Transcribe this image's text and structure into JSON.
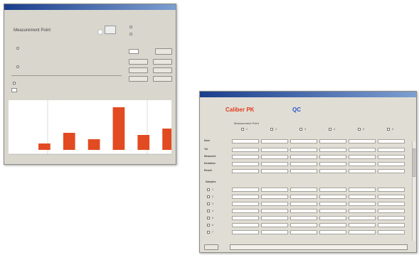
{
  "measure_window": {
    "title": "",
    "menu_label": "",
    "heading": "Measurement Point",
    "option_labels": [
      "",
      "",
      ""
    ],
    "checkbox_label": "",
    "right_group_title": "",
    "right_radio_labels": [
      "",
      ""
    ],
    "spin_value": "",
    "button_labels": [
      "",
      "",
      "",
      "",
      "",
      ""
    ],
    "chart_caption": "",
    "chart_data": {
      "type": "bar",
      "categories": [
        "",
        "",
        "",
        "",
        "",
        ""
      ],
      "values": [
        3,
        8,
        5,
        20,
        7,
        10
      ],
      "ylim": [
        0,
        22
      ],
      "bar_color": "#e24a21",
      "grid": true
    }
  },
  "spc_window": {
    "title": "",
    "menu_items": [
      "",
      "",
      "",
      "",
      "",
      ""
    ],
    "brand": "Caliber PK",
    "qc_label": "QC",
    "right_info": [
      "",
      ""
    ],
    "section_title": "Measurement Point",
    "column_numbers": [
      "1",
      "2",
      "3",
      "4",
      "5",
      "6"
    ],
    "row_labels": [
      "Nom",
      "Tol",
      "Measured",
      "Deviation",
      "Result"
    ],
    "samples_title": "Samples",
    "sample_numbers": [
      "1",
      "2",
      "3",
      "4",
      "5",
      "6",
      "7"
    ],
    "colors": {
      "brand": "#e23b1c",
      "qc": "#2a55c8",
      "title_bar": "#1a3e8c"
    }
  }
}
